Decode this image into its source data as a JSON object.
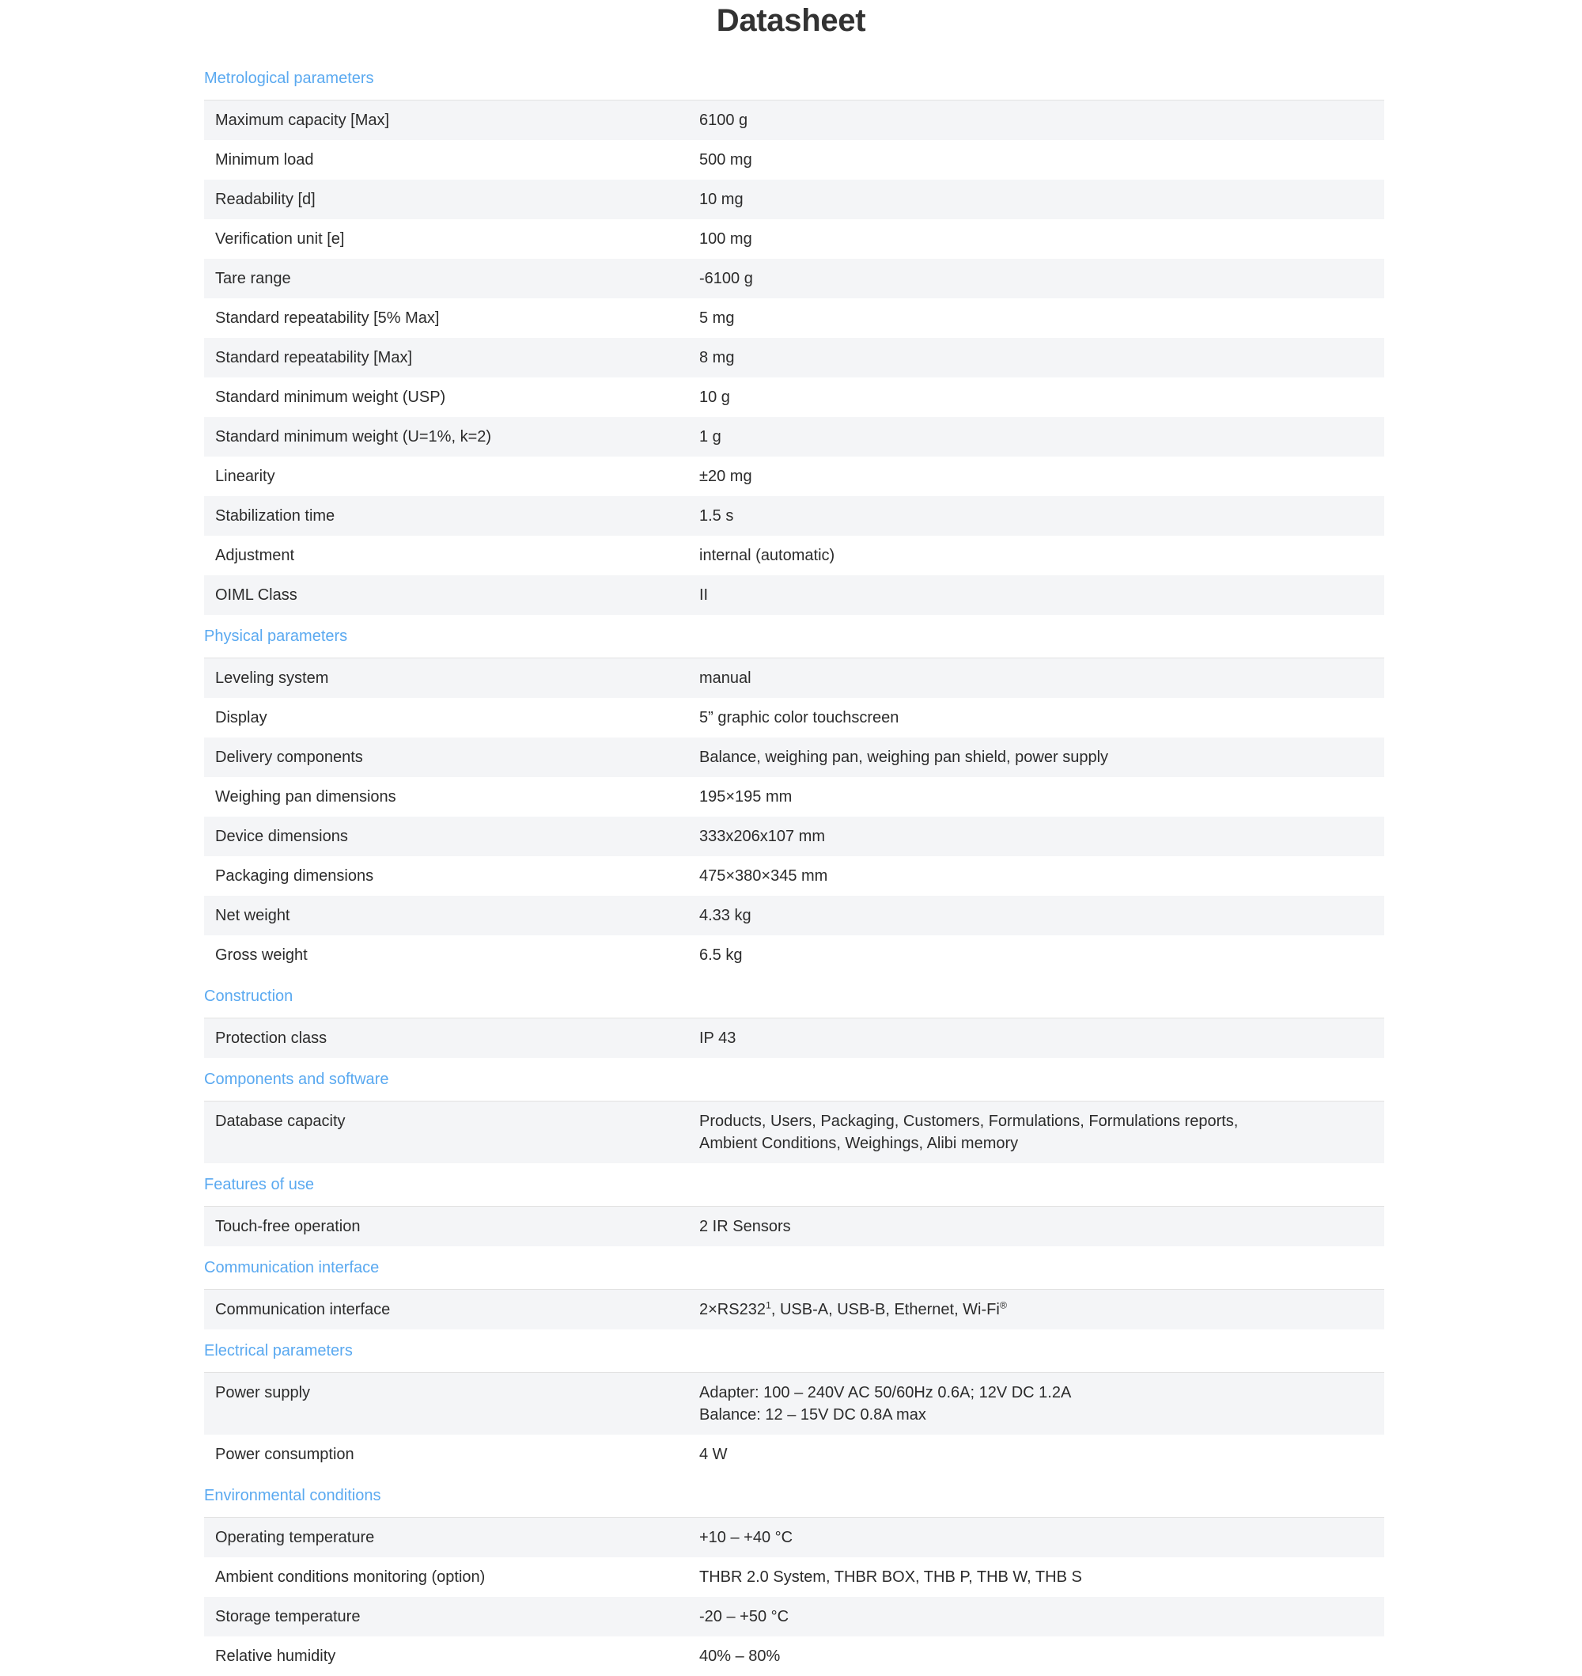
{
  "document": {
    "title": "Datasheet"
  },
  "theme": {
    "section_header_color": "#5aa9f0",
    "row_stripe_color": "#f4f5f7",
    "text_color": "#2b2b2b",
    "border_color": "#e2e2e2"
  },
  "sections": [
    {
      "id": "metrological-parameters",
      "title": "Metrological parameters",
      "rows": [
        {
          "key": "Maximum capacity [Max]",
          "value": "6100 g"
        },
        {
          "key": "Minimum load",
          "value": "500 mg"
        },
        {
          "key": "Readability [d]",
          "value": "10 mg"
        },
        {
          "key": "Verification unit [e]",
          "value": "100 mg"
        },
        {
          "key": "Tare range",
          "value": "-6100 g"
        },
        {
          "key": "Standard repeatability [5% Max]",
          "value": "5 mg"
        },
        {
          "key": "Standard repeatability [Max]",
          "value": "8 mg"
        },
        {
          "key": "Standard minimum weight (USP)",
          "value": "10 g"
        },
        {
          "key": "Standard minimum weight (U=1%, k=2)",
          "value": "1 g"
        },
        {
          "key": "Linearity",
          "value": "±20 mg"
        },
        {
          "key": "Stabilization time",
          "value": "1.5 s"
        },
        {
          "key": "Adjustment",
          "value": "internal (automatic)"
        },
        {
          "key": "OIML Class",
          "value": "II"
        }
      ]
    },
    {
      "id": "physical-parameters",
      "title": "Physical parameters",
      "rows": [
        {
          "key": "Leveling system",
          "value": "manual"
        },
        {
          "key": "Display",
          "value": "5” graphic color touchscreen"
        },
        {
          "key": "Delivery components",
          "value": "Balance, weighing pan, weighing pan shield, power supply"
        },
        {
          "key": "Weighing pan dimensions",
          "value": "195×195 mm"
        },
        {
          "key": "Device dimensions",
          "value": "333x206x107 mm"
        },
        {
          "key": "Packaging dimensions",
          "value": "475×380×345 mm"
        },
        {
          "key": "Net weight",
          "value": "4.33 kg"
        },
        {
          "key": "Gross weight",
          "value": "6.5 kg"
        }
      ]
    },
    {
      "id": "construction",
      "title": "Construction",
      "rows": [
        {
          "key": "Protection class",
          "value": "IP 43"
        }
      ]
    },
    {
      "id": "components-and-software",
      "title": "Components and software",
      "rows": [
        {
          "key": "Database capacity",
          "value": "Products, Users, Packaging, Customers, Formulations, Formulations reports, Ambient Conditions, Weighings, Alibi memory",
          "lines": [
            "Products, Users, Packaging, Customers, Formulations, Formulations reports,",
            "Ambient Conditions, Weighings, Alibi memory"
          ]
        }
      ]
    },
    {
      "id": "features-of-use",
      "title": "Features of use",
      "rows": [
        {
          "key": "Touch-free operation",
          "value": "2 IR Sensors"
        }
      ]
    },
    {
      "id": "communication-interface",
      "title": "Communication interface",
      "rows": [
        {
          "key": "Communication interface",
          "value": "2×RS232¹, USB-A, USB-B, Ethernet, Wi-Fi®",
          "rich": true,
          "parts": [
            {
              "text": "2×RS232",
              "sup": false
            },
            {
              "text": "1",
              "sup": true
            },
            {
              "text": ", USB-A, USB-B, Ethernet, Wi-Fi",
              "sup": false
            },
            {
              "text": "®",
              "sup": true
            }
          ]
        }
      ]
    },
    {
      "id": "electrical-parameters",
      "title": "Electrical parameters",
      "rows": [
        {
          "key": "Power supply",
          "value": "Adapter: 100 – 240V AC 50/60Hz 0.6A; 12V DC 1.2A Balance: 12 – 15V DC 0.8A max",
          "lines": [
            "Adapter: 100 – 240V AC 50/60Hz 0.6A; 12V DC 1.2A",
            "Balance: 12 – 15V DC 0.8A max"
          ]
        },
        {
          "key": "Power consumption",
          "value": "4 W"
        }
      ]
    },
    {
      "id": "environmental-conditions",
      "title": "Environmental conditions",
      "rows": [
        {
          "key": "Operating temperature",
          "value": "+10 – +40 °C"
        },
        {
          "key": "Ambient conditions monitoring (option)",
          "value": "THBR 2.0 System, THBR BOX, THB P, THB W, THB S"
        },
        {
          "key": "Storage temperature",
          "value": "-20 – +50 °C"
        },
        {
          "key": "Relative humidity",
          "value": "40% – 80%"
        }
      ]
    }
  ]
}
